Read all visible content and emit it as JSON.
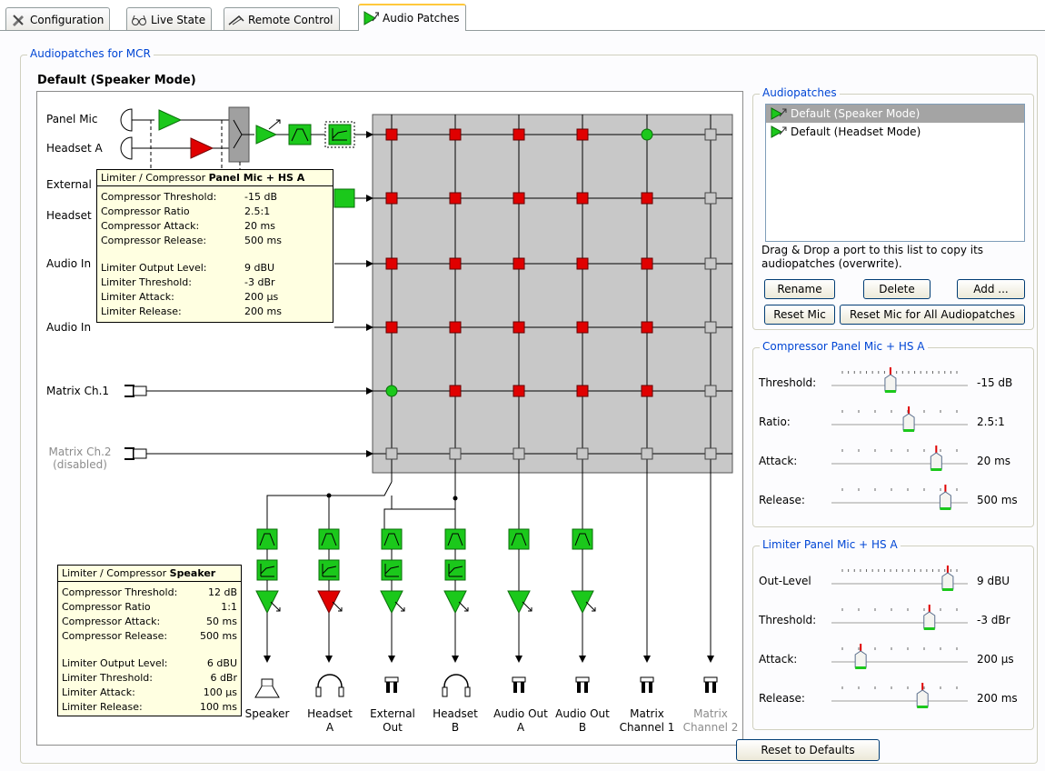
{
  "tabs": [
    {
      "label": "Configuration",
      "icon": "tools-icon"
    },
    {
      "label": "Live State",
      "icon": "glasses-icon"
    },
    {
      "label": "Remote Control",
      "icon": "remote-icon"
    },
    {
      "label": "Audio Patches",
      "icon": "audio-patch-icon"
    }
  ],
  "group_title": "Audiopatches for MCR",
  "patch_title": "Default (Speaker Mode)",
  "inputs": {
    "panel_mic": "Panel Mic",
    "headset_a": "Headset A",
    "external": "External",
    "headset": "Headset",
    "audio_in_1": "Audio In",
    "audio_in_2": "Audio In",
    "matrix_ch1": "Matrix Ch.1",
    "matrix_ch2": "Matrix Ch.2",
    "matrix_ch2_sub": "(disabled)"
  },
  "outputs": [
    {
      "line1": "Speaker",
      "line2": ""
    },
    {
      "line1": "Headset",
      "line2": "A"
    },
    {
      "line1": "External",
      "line2": "Out"
    },
    {
      "line1": "Headset",
      "line2": "B"
    },
    {
      "line1": "Audio Out",
      "line2": "A"
    },
    {
      "line1": "Audio Out",
      "line2": "B"
    },
    {
      "line1": "Matrix",
      "line2": "Channel 1"
    },
    {
      "line1": "Matrix",
      "line2": "Channel 2"
    }
  ],
  "tooltip_mic": {
    "prefix": "Limiter / Compressor ",
    "name": "Panel Mic + HS A",
    "rows": [
      {
        "k": "Compressor Threshold:",
        "v": "-15 dB"
      },
      {
        "k": "Compressor Ratio",
        "v": "2.5:1"
      },
      {
        "k": "Compressor Attack:",
        "v": "20 ms"
      },
      {
        "k": "Compressor Release:",
        "v": "500 ms"
      },
      {
        "k": "Limiter Output Level:",
        "v": "9 dBU"
      },
      {
        "k": "Limiter Threshold:",
        "v": "-3 dBr"
      },
      {
        "k": "Limiter Attack:",
        "v": "200 µs"
      },
      {
        "k": "Limiter Release:",
        "v": "200 ms"
      }
    ]
  },
  "tooltip_speaker": {
    "prefix": "Limiter / Compressor ",
    "name": "Speaker",
    "rows": [
      {
        "k": "Compressor Threshold:",
        "v": "12 dB"
      },
      {
        "k": "Compressor Ratio",
        "v": "1:1"
      },
      {
        "k": "Compressor Attack:",
        "v": "50 ms"
      },
      {
        "k": "Compressor Release:",
        "v": "500 ms"
      },
      {
        "k": "Limiter Output Level:",
        "v": "6 dBU"
      },
      {
        "k": "Limiter Threshold:",
        "v": "6 dBr"
      },
      {
        "k": "Limiter Attack:",
        "v": "100 µs"
      },
      {
        "k": "Limiter Release:",
        "v": "100 ms"
      }
    ]
  },
  "audiopatches": {
    "title": "Audiopatches",
    "items": [
      "Default (Speaker Mode)",
      "Default (Headset Mode)"
    ],
    "help": "Drag & Drop a port to this list to copy its audiopatches (overwrite).",
    "rename": "Rename",
    "delete": "Delete",
    "add": "Add ...",
    "reset_mic": "Reset Mic",
    "reset_mic_all": "Reset Mic for All Audiopatches"
  },
  "compressor": {
    "title": "Compressor Panel Mic + HS A",
    "rows": [
      {
        "label": "Threshold:",
        "value": "-15 dB",
        "level": 0.42
      },
      {
        "label": "Ratio:",
        "value": "2.5:1",
        "level": 0.58
      },
      {
        "label": "Attack:",
        "value": "20 ms",
        "level": 0.82
      },
      {
        "label": "Release:",
        "value": "500 ms",
        "level": 0.9
      }
    ]
  },
  "limiter": {
    "title": "Limiter Panel Mic + HS A",
    "rows": [
      {
        "label": "Out-Level",
        "value": "9 dBU",
        "level": 0.92
      },
      {
        "label": "Threshold:",
        "value": "-3 dBr",
        "level": 0.76
      },
      {
        "label": "Attack:",
        "value": "200 µs",
        "level": 0.16
      },
      {
        "label": "Release:",
        "value": "200 ms",
        "level": 0.7
      }
    ]
  },
  "reset_defaults": "Reset to Defaults",
  "matrix": {
    "rows": 6,
    "cols": 8,
    "states": [
      [
        "on",
        "on",
        "on",
        "on",
        "round-on",
        "off",
        "off",
        "off"
      ],
      [
        "on",
        "on",
        "on",
        "on",
        "on",
        "off",
        "off",
        "off"
      ],
      [
        "on",
        "on",
        "on",
        "on",
        "on",
        "off",
        "off",
        "off"
      ],
      [
        "on",
        "on",
        "on",
        "on",
        "on",
        "off",
        "off",
        "off"
      ],
      [
        "round-on",
        "on",
        "on",
        "on",
        "on",
        "off",
        "off",
        "off"
      ],
      [
        "off",
        "off",
        "off",
        "off",
        "off",
        "off",
        "off",
        "off"
      ]
    ]
  },
  "colors": {
    "accent": "#0046d5",
    "matrix_bg": "#c8c8c8",
    "cross_on": "#e00000",
    "cross_green": "#1bc81b",
    "cross_off": "#c8c8c8",
    "block_green": "#1bc81b",
    "amp_red": "#e00000"
  }
}
